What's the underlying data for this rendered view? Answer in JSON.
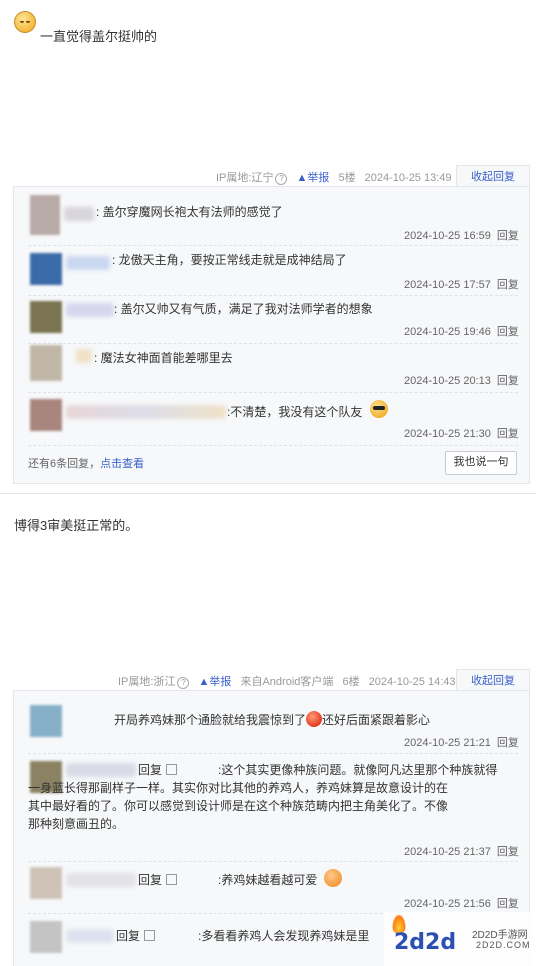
{
  "post1": {
    "text": "一直觉得盖尔挺帅的",
    "meta": {
      "ip": "IP属地:辽宁",
      "report": "举报",
      "floor": "5楼",
      "time": "2024-10-25 13:49",
      "collapse": "收起回复"
    },
    "replies": [
      {
        "text": ": 盖尔穿魔网长袍太有法师的感觉了",
        "time": "2024-10-25 16:59",
        "reply": "回复"
      },
      {
        "text": ": 龙傲天主角，要按正常线走就是成神结局了",
        "time": "2024-10-25 17:57",
        "reply": "回复"
      },
      {
        "text": ": 盖尔又帅又有气质，满足了我对法师学者的想象",
        "time": "2024-10-25 19:46",
        "reply": "回复"
      },
      {
        "text": ": 魔法女神面首能差哪里去",
        "time": "2024-10-25 20:13",
        "reply": "回复"
      },
      {
        "text": ":不清楚，我没有这个队友",
        "time": "2024-10-25 21:30",
        "reply": "回复"
      }
    ],
    "more": "还有6条回复，",
    "more_link": "点击查看",
    "say_button": "我也说一句"
  },
  "post2": {
    "text": "博得3审美挺正常的。",
    "meta": {
      "ip": "IP属地:浙江",
      "report": "举报",
      "client": "来自Android客户端",
      "floor": "6楼",
      "time": "2024-10-25 14:43",
      "collapse": "收起回复"
    },
    "replies": [
      {
        "text": "开局养鸡妹那个通脸就给我震惊到了",
        "text2": "还好后面紧跟着影心",
        "time": "2024-10-25 21:21",
        "reply": "回复"
      },
      {
        "prefix": "回复",
        "lines": [
          ":这个其实更像种族问题。就像阿凡达里那个种族就得",
          "一身蓝长得那副样子一样。其实你对比其他的养鸡人，养鸡妹算是故意设计的在",
          "其中最好看的了。你可以感觉到设计师是在这个种族范畴内把主角美化了。不像",
          "那种刻意画丑的。"
        ],
        "time": "2024-10-25 21:37",
        "reply": "回复"
      },
      {
        "prefix": "回复",
        "text": ":养鸡妹越看越可爱",
        "time": "2024-10-25 21:56",
        "reply": "回复"
      },
      {
        "prefix": "回复",
        "text": ":多看看养鸡人会发现养鸡妹是里"
      }
    ]
  },
  "watermark": {
    "logo": "2d2d",
    "site": "2D2D手游网",
    "url": "2D2D.COM"
  },
  "colors": {
    "link": "#3a5fcd",
    "panel_bg": "#f7f8fa",
    "border": "#e4e6eb"
  }
}
